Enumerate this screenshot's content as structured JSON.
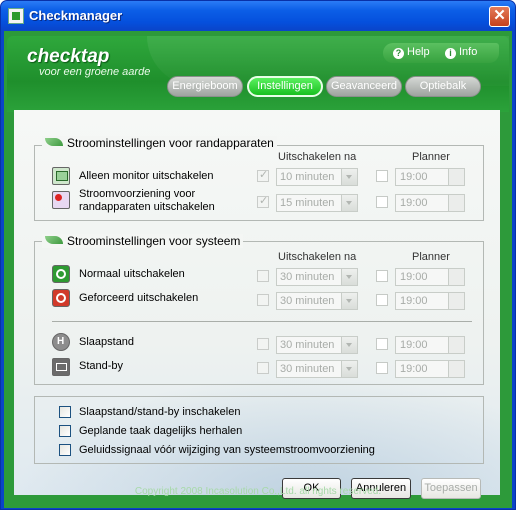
{
  "window": {
    "title": "Checkmanager",
    "close_label": "✕"
  },
  "header": {
    "logo": "checktap",
    "tagline": "voor een groene aarde",
    "help": "Help",
    "info": "Info"
  },
  "tabs": [
    {
      "label": "Energieboom",
      "active": false
    },
    {
      "label": "Instellingen",
      "active": true
    },
    {
      "label": "Geavanceerd",
      "active": false
    },
    {
      "label": "Optiebalk",
      "active": false
    }
  ],
  "devices": {
    "title": "Stroominstellingen voor randapparaten",
    "col_switch": "Uitschakelen na",
    "col_planner": "Planner",
    "rows": [
      {
        "label": "Alleen monitor uitschakelen",
        "checked": true,
        "value": "10 minuten",
        "planner_checked": false,
        "time": "19:00"
      },
      {
        "label": "Stroomvoorziening voor randapparaten uitschakelen",
        "label_line1": "Stroomvoorziening voor",
        "label_line2": "randapparaten uitschakelen",
        "checked": true,
        "value": "15 minuten",
        "planner_checked": false,
        "time": "19:00"
      }
    ]
  },
  "system": {
    "title": "Stroominstellingen voor systeem",
    "col_switch": "Uitschakelen na",
    "col_planner": "Planner",
    "rows": [
      {
        "label": "Normaal uitschakelen",
        "checked": false,
        "value": "30 minuten",
        "planner_checked": false,
        "time": "19:00"
      },
      {
        "label": "Geforceerd uitschakelen",
        "checked": false,
        "value": "30 minuten",
        "planner_checked": false,
        "time": "19:00"
      },
      {
        "label": "Slaapstand",
        "checked": false,
        "value": "30 minuten",
        "planner_checked": false,
        "time": "19:00"
      },
      {
        "label": "Stand-by",
        "checked": false,
        "value": "30 minuten",
        "planner_checked": false,
        "time": "19:00"
      }
    ]
  },
  "options": [
    {
      "label": "Slaapstand/stand-by inschakelen",
      "checked": false
    },
    {
      "label": "Geplande taak dagelijks herhalen",
      "checked": false
    },
    {
      "label": "Geluidssignaal vóór wijziging van systeemstroomvoorziening",
      "checked": false
    }
  ],
  "buttons": {
    "ok": "OK",
    "cancel": "Annuleren",
    "apply": "Toepassen"
  },
  "footer": "Copyright 2008 Incasolution Co.,Ltd. all rights reserved."
}
